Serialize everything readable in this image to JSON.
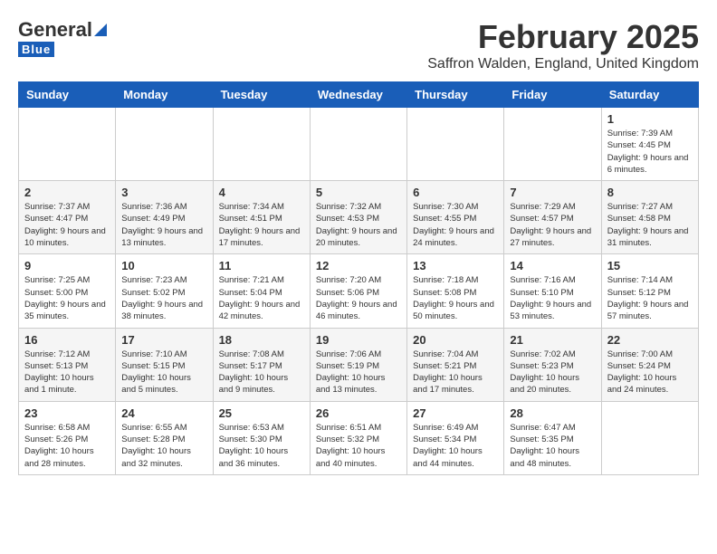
{
  "header": {
    "logo": {
      "general": "General",
      "blue": "Blue"
    },
    "title": "February 2025",
    "subtitle": "Saffron Walden, England, United Kingdom"
  },
  "calendar": {
    "days_of_week": [
      "Sunday",
      "Monday",
      "Tuesday",
      "Wednesday",
      "Thursday",
      "Friday",
      "Saturday"
    ],
    "weeks": [
      [
        {
          "day": "",
          "info": ""
        },
        {
          "day": "",
          "info": ""
        },
        {
          "day": "",
          "info": ""
        },
        {
          "day": "",
          "info": ""
        },
        {
          "day": "",
          "info": ""
        },
        {
          "day": "",
          "info": ""
        },
        {
          "day": "1",
          "info": "Sunrise: 7:39 AM\nSunset: 4:45 PM\nDaylight: 9 hours and 6 minutes."
        }
      ],
      [
        {
          "day": "2",
          "info": "Sunrise: 7:37 AM\nSunset: 4:47 PM\nDaylight: 9 hours and 10 minutes."
        },
        {
          "day": "3",
          "info": "Sunrise: 7:36 AM\nSunset: 4:49 PM\nDaylight: 9 hours and 13 minutes."
        },
        {
          "day": "4",
          "info": "Sunrise: 7:34 AM\nSunset: 4:51 PM\nDaylight: 9 hours and 17 minutes."
        },
        {
          "day": "5",
          "info": "Sunrise: 7:32 AM\nSunset: 4:53 PM\nDaylight: 9 hours and 20 minutes."
        },
        {
          "day": "6",
          "info": "Sunrise: 7:30 AM\nSunset: 4:55 PM\nDaylight: 9 hours and 24 minutes."
        },
        {
          "day": "7",
          "info": "Sunrise: 7:29 AM\nSunset: 4:57 PM\nDaylight: 9 hours and 27 minutes."
        },
        {
          "day": "8",
          "info": "Sunrise: 7:27 AM\nSunset: 4:58 PM\nDaylight: 9 hours and 31 minutes."
        }
      ],
      [
        {
          "day": "9",
          "info": "Sunrise: 7:25 AM\nSunset: 5:00 PM\nDaylight: 9 hours and 35 minutes."
        },
        {
          "day": "10",
          "info": "Sunrise: 7:23 AM\nSunset: 5:02 PM\nDaylight: 9 hours and 38 minutes."
        },
        {
          "day": "11",
          "info": "Sunrise: 7:21 AM\nSunset: 5:04 PM\nDaylight: 9 hours and 42 minutes."
        },
        {
          "day": "12",
          "info": "Sunrise: 7:20 AM\nSunset: 5:06 PM\nDaylight: 9 hours and 46 minutes."
        },
        {
          "day": "13",
          "info": "Sunrise: 7:18 AM\nSunset: 5:08 PM\nDaylight: 9 hours and 50 minutes."
        },
        {
          "day": "14",
          "info": "Sunrise: 7:16 AM\nSunset: 5:10 PM\nDaylight: 9 hours and 53 minutes."
        },
        {
          "day": "15",
          "info": "Sunrise: 7:14 AM\nSunset: 5:12 PM\nDaylight: 9 hours and 57 minutes."
        }
      ],
      [
        {
          "day": "16",
          "info": "Sunrise: 7:12 AM\nSunset: 5:13 PM\nDaylight: 10 hours and 1 minute."
        },
        {
          "day": "17",
          "info": "Sunrise: 7:10 AM\nSunset: 5:15 PM\nDaylight: 10 hours and 5 minutes."
        },
        {
          "day": "18",
          "info": "Sunrise: 7:08 AM\nSunset: 5:17 PM\nDaylight: 10 hours and 9 minutes."
        },
        {
          "day": "19",
          "info": "Sunrise: 7:06 AM\nSunset: 5:19 PM\nDaylight: 10 hours and 13 minutes."
        },
        {
          "day": "20",
          "info": "Sunrise: 7:04 AM\nSunset: 5:21 PM\nDaylight: 10 hours and 17 minutes."
        },
        {
          "day": "21",
          "info": "Sunrise: 7:02 AM\nSunset: 5:23 PM\nDaylight: 10 hours and 20 minutes."
        },
        {
          "day": "22",
          "info": "Sunrise: 7:00 AM\nSunset: 5:24 PM\nDaylight: 10 hours and 24 minutes."
        }
      ],
      [
        {
          "day": "23",
          "info": "Sunrise: 6:58 AM\nSunset: 5:26 PM\nDaylight: 10 hours and 28 minutes."
        },
        {
          "day": "24",
          "info": "Sunrise: 6:55 AM\nSunset: 5:28 PM\nDaylight: 10 hours and 32 minutes."
        },
        {
          "day": "25",
          "info": "Sunrise: 6:53 AM\nSunset: 5:30 PM\nDaylight: 10 hours and 36 minutes."
        },
        {
          "day": "26",
          "info": "Sunrise: 6:51 AM\nSunset: 5:32 PM\nDaylight: 10 hours and 40 minutes."
        },
        {
          "day": "27",
          "info": "Sunrise: 6:49 AM\nSunset: 5:34 PM\nDaylight: 10 hours and 44 minutes."
        },
        {
          "day": "28",
          "info": "Sunrise: 6:47 AM\nSunset: 5:35 PM\nDaylight: 10 hours and 48 minutes."
        },
        {
          "day": "",
          "info": ""
        }
      ]
    ]
  }
}
